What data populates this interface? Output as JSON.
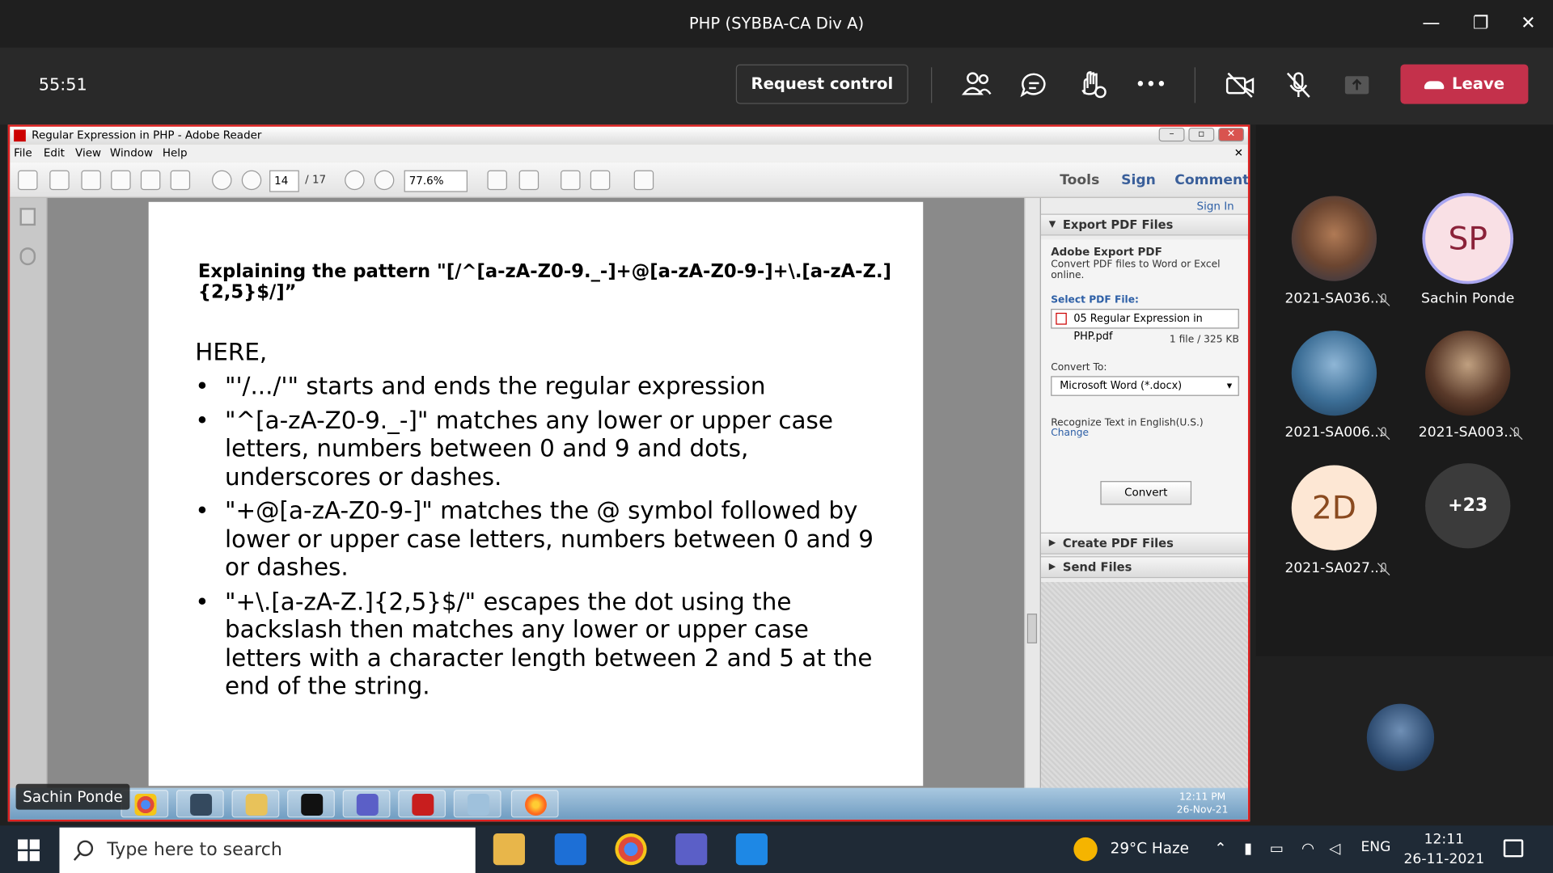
{
  "teams": {
    "title": "PHP (SYBBA-CA Div A)",
    "timer": "55:51",
    "request_control": "Request control",
    "leave": "Leave",
    "more": "•••"
  },
  "reader": {
    "title": "Regular Expression in PHP - Adobe Reader",
    "menu": [
      "File",
      "Edit",
      "View",
      "Window",
      "Help"
    ],
    "page_current": "14",
    "page_total": "/ 17",
    "zoom": "77.6%",
    "tools": "Tools",
    "sign": "Sign",
    "comment": "Comment",
    "sign_in": "Sign In",
    "panel": {
      "export_header": "Export PDF Files",
      "adobe_export": "Adobe Export PDF",
      "export_desc": "Convert PDF files to Word or Excel online.",
      "select_label": "Select PDF File:",
      "file_name": "05 Regular Expression in PHP.pdf",
      "file_info": "1 file / 325 KB",
      "convert_to_label": "Convert To:",
      "convert_to_value": "Microsoft Word (*.docx)",
      "recognize": "Recognize Text in English(U.S.)",
      "change": "Change",
      "convert_button": "Convert",
      "create_header": "Create PDF Files",
      "send_header": "Send Files"
    },
    "doc": {
      "heading": "Explaining the pattern \"[/^[a-zA-Z0-9._-]+@[a-zA-Z0-9-]+\\.[a-zA-Z.]{2,5}$/]”",
      "here": "HERE,",
      "bullets": [
        "\"'/.../'\" starts and ends the regular expression",
        "\"^[a-zA-Z0-9._-]\" matches any lower or upper case letters, numbers between 0 and 9 and dots, underscores or dashes.",
        "\"+@[a-zA-Z0-9-]\" matches the @ symbol followed by lower or upper case letters, numbers between 0 and 9 or dashes.",
        "\"+\\.[a-zA-Z.]{2,5}$/\" escapes the dot using the backslash then matches any lower or upper case letters with a character length between 2 and 5 at the end of the string."
      ]
    },
    "inner_clock_time": "12:11 PM",
    "inner_clock_date": "26-Nov-21"
  },
  "presenter_chip": "Sachin Ponde",
  "participants": [
    {
      "name": "2021-SA036...",
      "muted": true
    },
    {
      "name": "Sachin Ponde",
      "initials": "SP",
      "muted": false
    },
    {
      "name": "2021-SA006...",
      "muted": true
    },
    {
      "name": "2021-SA003...",
      "muted": true
    },
    {
      "name": "2021-SA027...",
      "initials": "2D",
      "muted": true
    },
    {
      "name": "",
      "initials": "+23"
    }
  ],
  "taskbar": {
    "search_placeholder": "Type here to search",
    "weather": "29°C  Haze",
    "lang": "ENG",
    "time": "12:11",
    "date": "26-11-2021"
  },
  "colors": {
    "leave": "#c4314b",
    "share_border": "#e02020",
    "sp_ring": "#a9a6f0"
  }
}
